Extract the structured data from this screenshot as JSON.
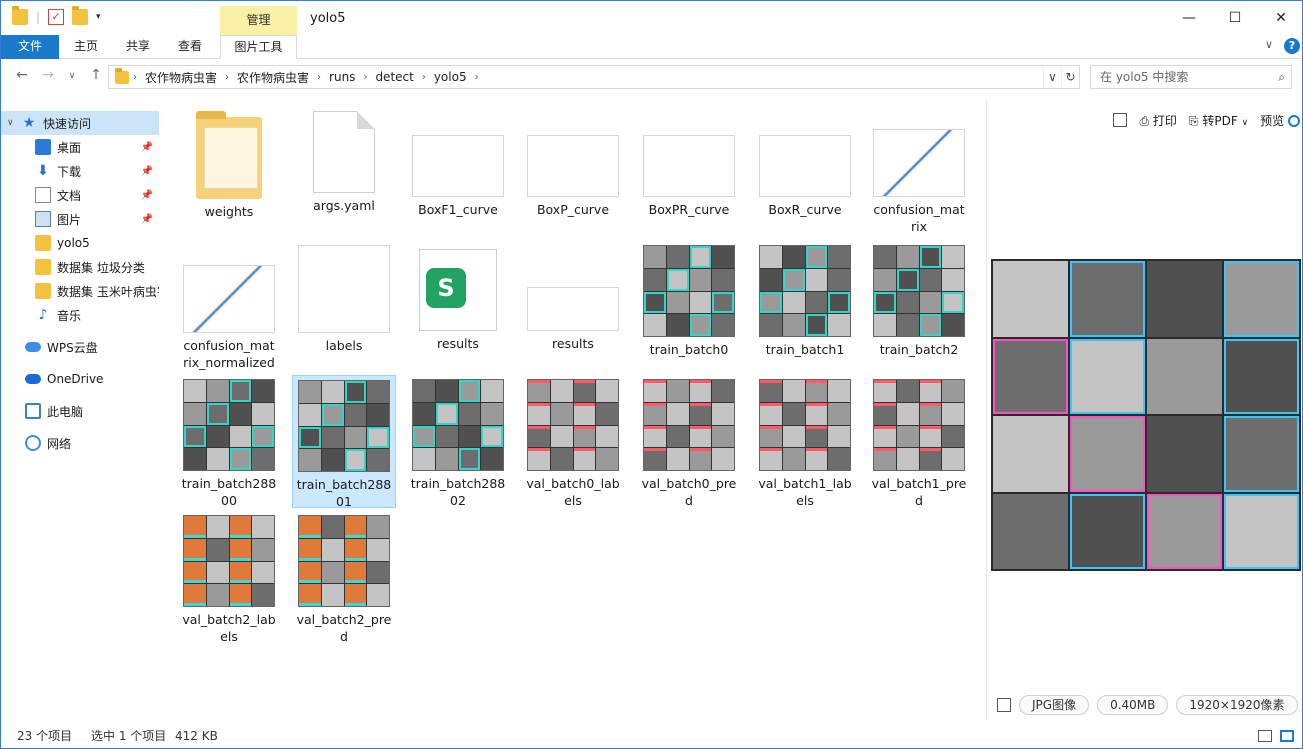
{
  "titlebar": {
    "manage_tab": "管理",
    "title": "yolo5",
    "minimize": "—",
    "maximize": "☐",
    "close": "✕"
  },
  "ribbon": {
    "tabs": [
      "文件",
      "主页",
      "共享",
      "查看",
      "图片工具"
    ],
    "collapse": "∨",
    "help": "?"
  },
  "address": {
    "crumbs": [
      "农作物病虫害",
      "农作物病虫害",
      "runs",
      "detect",
      "yolo5"
    ],
    "search_placeholder": "在 yolo5 中搜索"
  },
  "sidebar": {
    "items": [
      {
        "label": "快速访问",
        "icon": "star-icon"
      },
      {
        "label": "桌面",
        "icon": "desktop-icon"
      },
      {
        "label": "下载",
        "icon": "download-icon"
      },
      {
        "label": "文档",
        "icon": "document-icon"
      },
      {
        "label": "图片",
        "icon": "pictures-icon"
      },
      {
        "label": "yolo5",
        "icon": "folder-icon"
      },
      {
        "label": "数据集 垃圾分类",
        "icon": "folder-icon"
      },
      {
        "label": "数据集 玉米叶病虫害",
        "icon": "folder-icon"
      },
      {
        "label": "音乐",
        "icon": "music-icon"
      },
      {
        "label": "WPS云盘",
        "icon": "cloud-icon"
      },
      {
        "label": "OneDrive",
        "icon": "cloud-icon"
      },
      {
        "label": "此电脑",
        "icon": "computer-icon"
      },
      {
        "label": "网络",
        "icon": "network-icon"
      }
    ]
  },
  "files": [
    {
      "name": "weights",
      "kind": "folder"
    },
    {
      "name": "args.yaml",
      "kind": "blank"
    },
    {
      "name": "BoxF1_curve",
      "kind": "chart"
    },
    {
      "name": "BoxP_curve",
      "kind": "chart"
    },
    {
      "name": "BoxPR_curve",
      "kind": "chart"
    },
    {
      "name": "BoxR_curve",
      "kind": "chart"
    },
    {
      "name": "confusion_matrix",
      "kind": "confmat"
    },
    {
      "name": "confusion_matrix_normalized",
      "kind": "confmat"
    },
    {
      "name": "labels",
      "kind": "chart"
    },
    {
      "name": "results",
      "kind": "sheet"
    },
    {
      "name": "results",
      "kind": "chart"
    },
    {
      "name": "train_batch0",
      "kind": "mosaic"
    },
    {
      "name": "train_batch1",
      "kind": "mosaic"
    },
    {
      "name": "train_batch2",
      "kind": "mosaic"
    },
    {
      "name": "train_batch28800",
      "kind": "mosaic"
    },
    {
      "name": "train_batch28801",
      "kind": "mosaic",
      "selected": true
    },
    {
      "name": "train_batch28802",
      "kind": "mosaic"
    },
    {
      "name": "val_batch0_labels",
      "kind": "val"
    },
    {
      "name": "val_batch0_pred",
      "kind": "val"
    },
    {
      "name": "val_batch1_labels",
      "kind": "val"
    },
    {
      "name": "val_batch1_pred",
      "kind": "val"
    },
    {
      "name": "val_batch2_labels",
      "kind": "val2"
    },
    {
      "name": "val_batch2_pred",
      "kind": "val2"
    }
  ],
  "preview": {
    "print": "打印",
    "to_pdf": "转PDF",
    "preview": "预览",
    "type": "JPG图像",
    "size": "0.40MB",
    "dims": "1920×1920像素"
  },
  "status": {
    "count": "23 个项目",
    "selection": "选中 1 个项目",
    "filesize": "412 KB"
  }
}
